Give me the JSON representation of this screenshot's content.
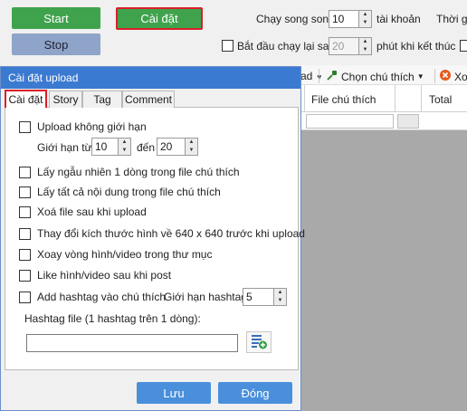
{
  "main": {
    "start_label": "Start",
    "install_label": "Cài đặt",
    "stop_label": "Stop",
    "parallel_label": "Chạy song song",
    "parallel_value": "10",
    "accounts_label": "tài khoản",
    "time_label": "Thời gi",
    "restart_label": "Bắt đầu chạy lại sau",
    "restart_value": "20",
    "restart_suffix": "phút khi kết thúc"
  },
  "toolbar": {
    "partial_label": "ad",
    "choose_caption_label": "Chọn chú thích",
    "delete_partial_label": "Xo"
  },
  "grid": {
    "columns": [
      "File chú thích",
      "Total"
    ]
  },
  "dialog": {
    "title": "Cài đặt upload",
    "tabs": [
      "Cài đặt",
      "Story",
      "Tag",
      "Comment"
    ],
    "options": {
      "unlimited_upload": "Upload không giới hạn",
      "limit_from_label": "Giới hạn từ",
      "limit_from_value": "10",
      "limit_to_label": "đến",
      "limit_to_value": "20",
      "random_line": "Lấy ngẫu nhiên 1 dòng trong file chú thích",
      "all_content": "Lấy tất cả nội dung trong file chú thích",
      "delete_after": "Xoá file sau khi upload",
      "resize_image": "Thay đổi kích thước hình về 640 x 640 trước khi upload",
      "rotate_media": "Xoay vòng hình/video trong thư mục",
      "like_after": "Like hình/video sau khi post",
      "add_hashtag": "Add hashtag vào chú thích",
      "hashtag_limit_label": "Giới hạn hashtag:",
      "hashtag_limit_value": "5",
      "hashtag_file_label": "Hashtag file (1 hashtag trên 1 dòng):",
      "hashtag_file_value": ""
    },
    "save_label": "Lưu",
    "close_label": "Đóng"
  },
  "colors": {
    "green": "#3fa34d",
    "highlight_red": "#d91f2a",
    "title_blue": "#3b7ad1",
    "button_blue": "#4a8fdb",
    "stop_blue": "#8ea4c8"
  }
}
